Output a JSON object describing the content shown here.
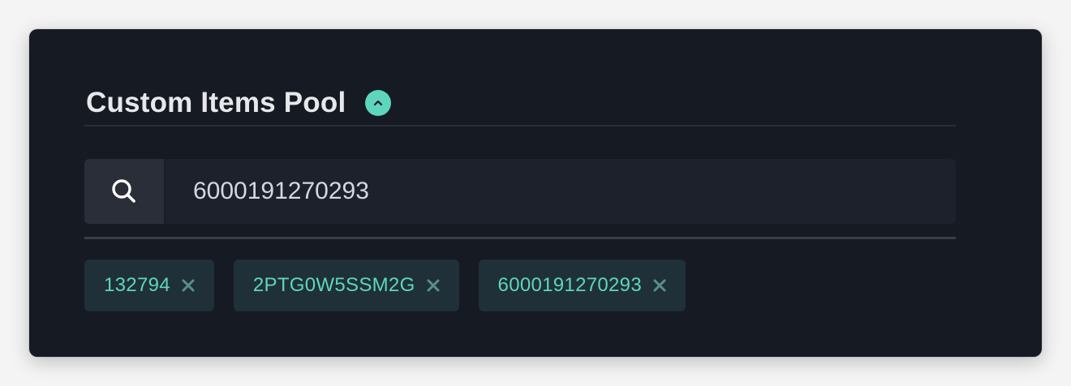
{
  "panel": {
    "title": "Custom Items Pool",
    "toggle_icon": "chevron-up-icon"
  },
  "search": {
    "icon": "search-icon",
    "value": "6000191270293",
    "placeholder": ""
  },
  "tags": [
    {
      "label": "132794",
      "remove_icon": "close-icon"
    },
    {
      "label": "2PTG0W5SSM2G",
      "remove_icon": "close-icon"
    },
    {
      "label": "6000191270293",
      "remove_icon": "close-icon"
    }
  ],
  "colors": {
    "accent": "#5ed6bd",
    "panel_bg": "#161a22",
    "tag_bg": "#1f3039",
    "title_text": "#e6e8ec"
  }
}
